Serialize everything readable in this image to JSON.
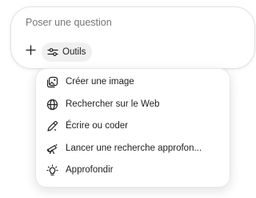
{
  "composer": {
    "placeholder": "Poser une question",
    "tools_label": "Outils"
  },
  "tools_menu": {
    "items": [
      {
        "label": "Créer une image",
        "icon": "image-icon"
      },
      {
        "label": "Rechercher sur le Web",
        "icon": "globe-icon"
      },
      {
        "label": "Écrire ou coder",
        "icon": "pen-icon"
      },
      {
        "label": "Lancer une recherche approfon...",
        "icon": "telescope-icon"
      },
      {
        "label": "Approfondir",
        "icon": "lightbulb-icon"
      }
    ]
  }
}
